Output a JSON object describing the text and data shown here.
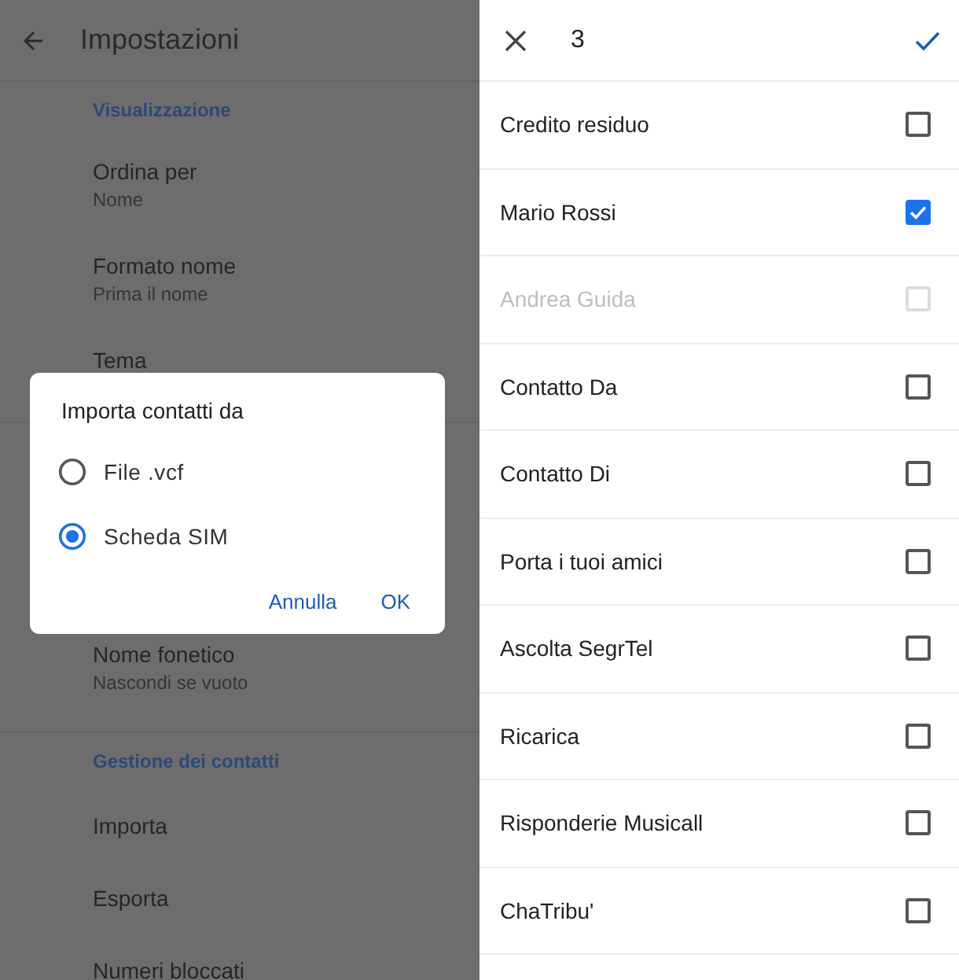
{
  "settings": {
    "title": "Impostazioni",
    "sections": [
      {
        "header": "Visualizzazione",
        "items": [
          {
            "title": "Ordina per",
            "subtitle": "Nome"
          },
          {
            "title": "Formato nome",
            "subtitle": "Prima il nome"
          },
          {
            "title": "Tema"
          }
        ]
      },
      {
        "items": [
          {
            "title": "Nome fonetico",
            "subtitle": "Nascondi se vuoto"
          }
        ]
      },
      {
        "header": "Gestione dei contatti",
        "items": [
          {
            "title": "Importa"
          },
          {
            "title": "Esporta"
          },
          {
            "title": "Numeri bloccati"
          }
        ]
      }
    ]
  },
  "dialog": {
    "title": "Importa contatti da",
    "options": [
      {
        "label": "File .vcf",
        "selected": false
      },
      {
        "label": "Scheda SIM",
        "selected": true
      }
    ],
    "buttons": [
      "Annulla",
      "OK"
    ]
  },
  "picker": {
    "count": "3",
    "rows": [
      {
        "name": "Credito residuo",
        "checked": false,
        "disabled": false
      },
      {
        "name": "Mario Rossi",
        "checked": true,
        "disabled": false
      },
      {
        "name": "Andrea Guida",
        "checked": false,
        "disabled": true
      },
      {
        "name": "Contatto Da",
        "checked": false,
        "disabled": false
      },
      {
        "name": "Contatto Di",
        "checked": false,
        "disabled": false
      },
      {
        "name": "Porta i tuoi amici",
        "checked": false,
        "disabled": false
      },
      {
        "name": "Ascolta SegrTel",
        "checked": false,
        "disabled": false
      },
      {
        "name": "Ricarica",
        "checked": false,
        "disabled": false
      },
      {
        "name": "Risponderie Musicall",
        "checked": false,
        "disabled": false
      },
      {
        "name": "ChaTribu'",
        "checked": false,
        "disabled": false
      }
    ]
  }
}
